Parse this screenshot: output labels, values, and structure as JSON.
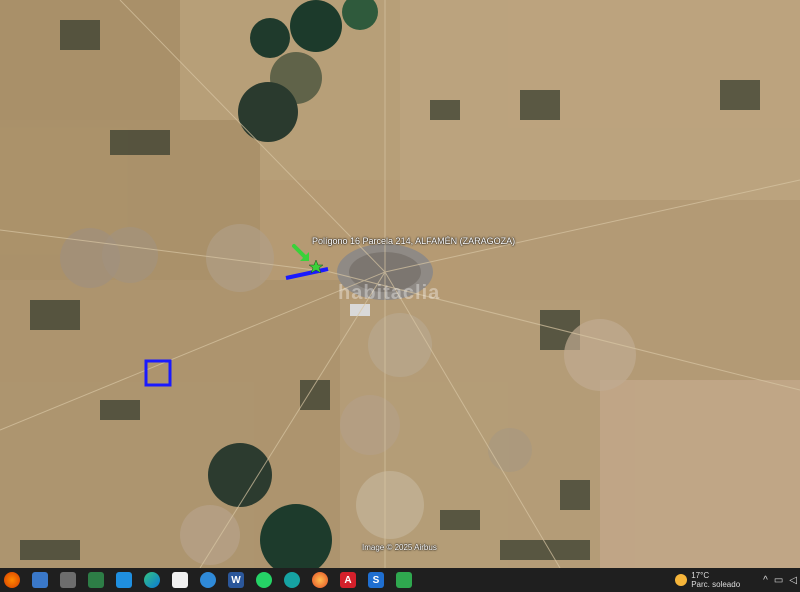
{
  "map": {
    "place_label": "Polígono 16 Parcela 214, ALFAMÉN (ZARAGOZA)",
    "copyright": "Image © 2025 Airbus",
    "watermark": "habitaclia",
    "colors": {
      "ground": "#b59a73",
      "field_dark": "#2b3a2b",
      "field_green": "#2f4a34",
      "parcel_outline": "#1a1aff",
      "road_highlight": "#1a1aff",
      "arrow": "#39d23a",
      "star": "#3bd13a"
    },
    "markers": [
      {
        "type": "arrow",
        "icon": "green-arrow-icon"
      },
      {
        "type": "star",
        "icon": "green-star-icon"
      }
    ]
  },
  "taskbar": {
    "apps": [
      {
        "name": "start",
        "icon": "start-icon"
      },
      {
        "name": "app-1",
        "icon": "app-icon"
      },
      {
        "name": "app-2",
        "icon": "app-icon"
      },
      {
        "name": "app-3",
        "icon": "app-icon"
      },
      {
        "name": "photos",
        "icon": "photos-icon"
      },
      {
        "name": "edge",
        "icon": "edge-icon"
      },
      {
        "name": "file",
        "icon": "file-icon"
      },
      {
        "name": "globe",
        "icon": "globe-icon"
      },
      {
        "name": "word",
        "icon": "word-icon"
      },
      {
        "name": "whatsapp",
        "icon": "whatsapp-icon"
      },
      {
        "name": "app-c",
        "icon": "app-icon"
      },
      {
        "name": "firefox",
        "icon": "firefox-icon"
      },
      {
        "name": "acrobat",
        "icon": "acrobat-icon"
      },
      {
        "name": "app-s",
        "icon": "app-icon"
      },
      {
        "name": "app-green",
        "icon": "app-icon"
      }
    ],
    "weather": {
      "temp": "17°C",
      "desc": "Parc. soleado"
    }
  }
}
